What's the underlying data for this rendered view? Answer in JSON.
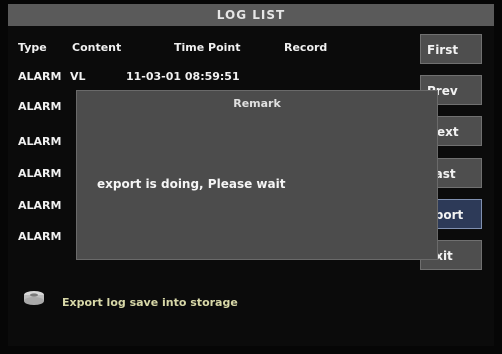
{
  "window": {
    "title": "LOG LIST"
  },
  "table": {
    "headers": {
      "type": "Type",
      "content": "Content",
      "time_point": "Time Point",
      "record": "Record"
    },
    "rows": [
      {
        "type": "ALARM",
        "content": "VL",
        "time": "11-03-01  08:59:51"
      },
      {
        "type": "ALARM",
        "content": "",
        "time": ""
      },
      {
        "type": "ALARM",
        "content": "",
        "time": ""
      },
      {
        "type": "ALARM",
        "content": "",
        "time": ""
      },
      {
        "type": "ALARM",
        "content": "",
        "time": ""
      },
      {
        "type": "ALARM",
        "content": "",
        "time": ""
      }
    ]
  },
  "buttons": {
    "first": "First",
    "prev": "Prev",
    "next": "Next",
    "last": "Last",
    "export": "xport",
    "exit": "Exit"
  },
  "dialog": {
    "title": "Remark",
    "message": "export is doing, Please wait"
  },
  "status": {
    "icon": "storage-disk-icon",
    "text": "Export log save into storage"
  },
  "colors": {
    "title_bar": "#5a5a5a",
    "button_bg": "#4e4e4e",
    "button_selected": "#2d3a58",
    "dialog_bg": "#4c4c4c",
    "text": "#f0f0f0",
    "status_text": "#d8d8a8"
  }
}
